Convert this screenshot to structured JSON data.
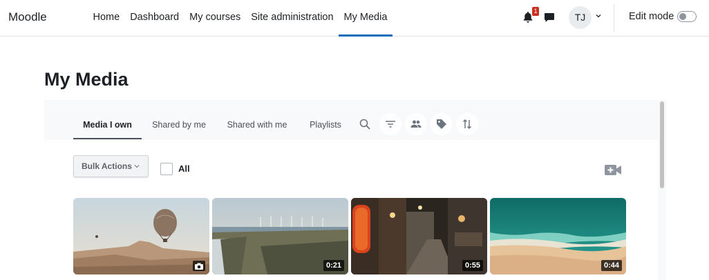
{
  "navbar": {
    "brand": "Moodle",
    "links": [
      {
        "label": "Home",
        "active": false
      },
      {
        "label": "Dashboard",
        "active": false
      },
      {
        "label": "My courses",
        "active": false
      },
      {
        "label": "Site administration",
        "active": false
      },
      {
        "label": "My Media",
        "active": true
      }
    ],
    "notification_count": "1",
    "avatar_initials": "TJ",
    "edit_mode_label": "Edit mode",
    "edit_mode_on": false
  },
  "page": {
    "title": "My Media"
  },
  "tabs": [
    {
      "label": "Media I own",
      "active": true
    },
    {
      "label": "Shared by me",
      "active": false
    },
    {
      "label": "Shared with me",
      "active": false
    },
    {
      "label": "Playlists",
      "active": false
    }
  ],
  "toolbar_icons": [
    "search-icon",
    "filter-icon",
    "people-icon",
    "tag-icon",
    "sort-icon"
  ],
  "bulk_actions_label": "Bulk Actions",
  "select_all_label": "All",
  "media": [
    {
      "type": "image",
      "duration": "",
      "scene": "hot air balloon over rocky valley"
    },
    {
      "type": "video",
      "duration": "0:21",
      "scene": "wind turbines along coastline"
    },
    {
      "type": "video",
      "duration": "0:55",
      "scene": "narrow street with lanterns at night"
    },
    {
      "type": "video",
      "duration": "0:44",
      "scene": "aerial beach with waves"
    }
  ],
  "colors": {
    "accent": "#0f6cbf",
    "badge": "#ca3120",
    "tabbar_bg": "#f8f9fa"
  }
}
